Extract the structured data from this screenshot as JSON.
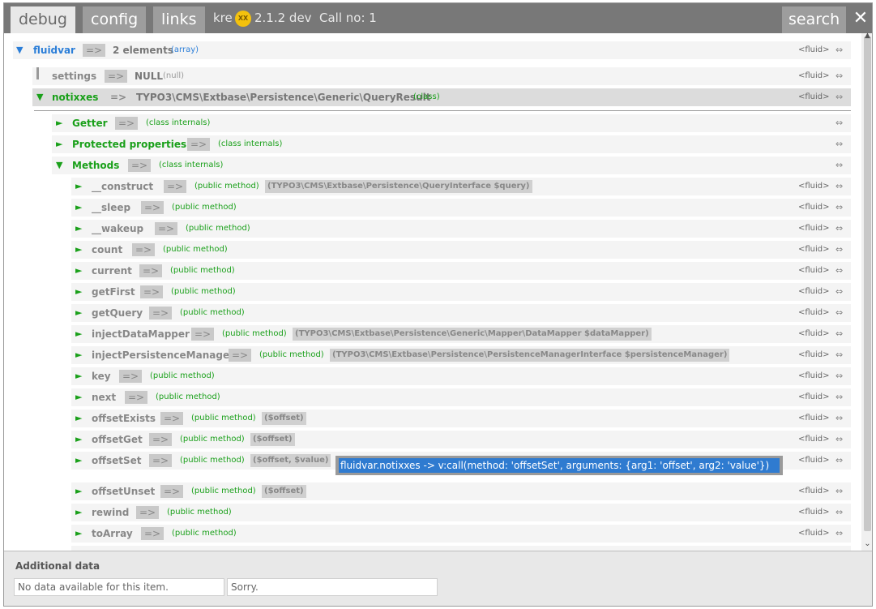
{
  "tabs": [
    {
      "label": "debug",
      "active": true
    },
    {
      "label": "config",
      "active": false
    },
    {
      "label": "links",
      "active": false
    }
  ],
  "title": {
    "kre": "kre",
    "logo_text": "XX",
    "version": "2.1.2 dev",
    "call": "Call no: 1"
  },
  "search_label": "search",
  "operator": "=>",
  "fluid_label": "<fluid>",
  "swap_glyph": "⇔",
  "tree": {
    "root": {
      "key": "fluidvar",
      "value": "2 elements",
      "note": "(array)"
    },
    "settings": {
      "key": "settings",
      "value": "NULL",
      "note": "(null)"
    },
    "notixxes": {
      "key": "notixxes",
      "value": "TYPO3\\CMS\\Extbase\\Persistence\\Generic\\QueryResult",
      "note": "(class)"
    },
    "groups": [
      {
        "key": "Getter",
        "note": "(class internals)"
      },
      {
        "key": "Protected properties",
        "note": "(class internals)"
      },
      {
        "key": "Methods",
        "note": "(class internals)"
      }
    ],
    "methods": [
      {
        "name": "__construct",
        "note": "(public method)",
        "params": "(TYPO3\\CMS\\Extbase\\Persistence\\QueryInterface $query)"
      },
      {
        "name": "__sleep",
        "note": "(public method)",
        "params": ""
      },
      {
        "name": "__wakeup",
        "note": "(public method)",
        "params": ""
      },
      {
        "name": "count",
        "note": "(public method)",
        "params": ""
      },
      {
        "name": "current",
        "note": "(public method)",
        "params": ""
      },
      {
        "name": "getFirst",
        "note": "(public method)",
        "params": ""
      },
      {
        "name": "getQuery",
        "note": "(public method)",
        "params": ""
      },
      {
        "name": "injectDataMapper",
        "note": "(public method)",
        "params": "(TYPO3\\CMS\\Extbase\\Persistence\\Generic\\Mapper\\DataMapper $dataMapper)"
      },
      {
        "name": "injectPersistenceManager",
        "note": "(public method)",
        "params": "(TYPO3\\CMS\\Extbase\\Persistence\\PersistenceManagerInterface $persistenceManager)"
      },
      {
        "name": "key",
        "note": "(public method)",
        "params": ""
      },
      {
        "name": "next",
        "note": "(public method)",
        "params": ""
      },
      {
        "name": "offsetExists",
        "note": "(public method)",
        "params": "($offset)"
      },
      {
        "name": "offsetGet",
        "note": "(public method)",
        "params": "($offset)"
      },
      {
        "name": "offsetSet",
        "note": "(public method)",
        "params": "($offset, $value)"
      },
      {
        "name": "offsetUnset",
        "note": "(public method)",
        "params": "($offset)"
      },
      {
        "name": "rewind",
        "note": "(public method)",
        "params": ""
      },
      {
        "name": "toArray",
        "note": "(public method)",
        "params": ""
      }
    ]
  },
  "tooltip": "fluidvar.notixxes -> v:call(method: 'offsetSet', arguments: {arg1: 'offset', arg2: 'value'})",
  "additional": {
    "title": "Additional data",
    "field1": "No data available for this item.",
    "field2": "Sorry."
  }
}
